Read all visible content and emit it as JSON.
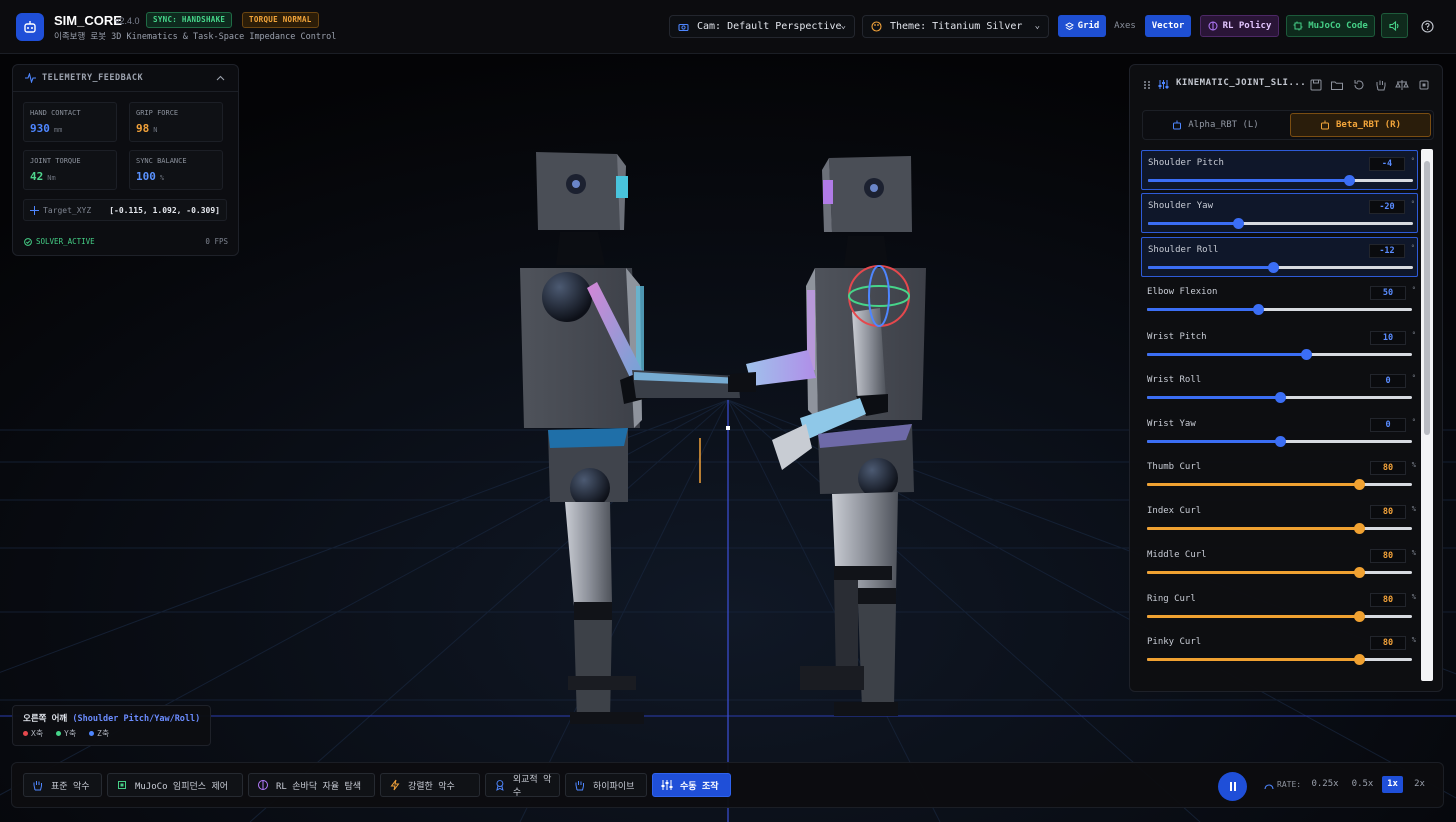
{
  "header": {
    "app_title": "SIM_CORE",
    "version": "v2.4.0",
    "subtitle": "이족보행 로봇 3D Kinematics & Task-Space Impedance Control",
    "badges": {
      "sync": "SYNC: HANDSHAKE",
      "torque": "TORQUE NORMAL"
    },
    "camera_select": "Cam: Default Perspective",
    "theme_select": "Theme: Titanium Silver",
    "toggles": {
      "grid": "Grid",
      "axes": "Axes",
      "vector": "Vector"
    },
    "rl_policy": "RL Policy",
    "mujoco_code": "MuJoCo Code"
  },
  "telemetry": {
    "title": "TELEMETRY_FEEDBACK",
    "hand_contact": {
      "label": "HAND CONTACT",
      "value": "930",
      "unit": "mm"
    },
    "grip_force": {
      "label": "GRIP FORCE",
      "value": "98",
      "unit": "N"
    },
    "joint_torque": {
      "label": "JOINT TORQUE",
      "value": "42",
      "unit": "Nm"
    },
    "sync_balance": {
      "label": "SYNC BALANCE",
      "value": "100",
      "unit": "%"
    },
    "target_label": "Target_XYZ",
    "target_value": "[-0.115, 1.092, -0.309]",
    "solver": "SOLVER_ACTIVE",
    "fps": "0 FPS"
  },
  "joint_panel": {
    "title": "KINEMATIC_JOINT_SLI...",
    "tabs": {
      "alpha": "Alpha_RBT (L)",
      "beta": "Beta_RBT (R)"
    },
    "joints": [
      {
        "name": "Shoulder Pitch",
        "value": "-4",
        "unit": "°",
        "level": 0.76,
        "color": "blue",
        "active": true
      },
      {
        "name": "Shoulder Yaw",
        "value": "-20",
        "unit": "°",
        "level": 0.34,
        "color": "blue",
        "active": true
      },
      {
        "name": "Shoulder Roll",
        "value": "-12",
        "unit": "°",
        "level": 0.47,
        "color": "blue",
        "active": true
      },
      {
        "name": "Elbow Flexion",
        "value": "50",
        "unit": "°",
        "level": 0.42,
        "color": "blue",
        "active": false
      },
      {
        "name": "Wrist Pitch",
        "value": "10",
        "unit": "°",
        "level": 0.6,
        "color": "blue",
        "active": false
      },
      {
        "name": "Wrist Roll",
        "value": "0",
        "unit": "°",
        "level": 0.5,
        "color": "blue",
        "active": false
      },
      {
        "name": "Wrist Yaw",
        "value": "0",
        "unit": "°",
        "level": 0.5,
        "color": "blue",
        "active": false
      },
      {
        "name": "Thumb Curl",
        "value": "80",
        "unit": "%",
        "level": 0.8,
        "color": "orange",
        "active": false
      },
      {
        "name": "Index Curl",
        "value": "80",
        "unit": "%",
        "level": 0.8,
        "color": "orange",
        "active": false
      },
      {
        "name": "Middle Curl",
        "value": "80",
        "unit": "%",
        "level": 0.8,
        "color": "orange",
        "active": false
      },
      {
        "name": "Ring Curl",
        "value": "80",
        "unit": "%",
        "level": 0.8,
        "color": "orange",
        "active": false
      },
      {
        "name": "Pinky Curl",
        "value": "80",
        "unit": "%",
        "level": 0.8,
        "color": "orange",
        "active": false
      }
    ]
  },
  "shoulder_legend": {
    "title": "오른쪽 어깨",
    "title_detail": "(Shoulder Pitch/Yaw/Roll)",
    "x_axis": "X축",
    "y_axis": "Y축",
    "z_axis": "Z축"
  },
  "modes": [
    {
      "label": "표준 악수",
      "icon": "hand-icon",
      "active": false
    },
    {
      "label": "MuJoCo 임피던스 제어",
      "icon": "chip-icon",
      "active": false
    },
    {
      "label": "RL 손바닥 자율 탐색",
      "icon": "brain-icon",
      "active": false
    },
    {
      "label": "강렬한 악수",
      "icon": "bolt-icon",
      "active": false
    },
    {
      "label": "외교적 악수",
      "icon": "award-icon",
      "active": false
    },
    {
      "label": "하이파이브",
      "icon": "hand-icon",
      "active": false
    },
    {
      "label": "수동 조작",
      "icon": "sliders-icon",
      "active": true
    }
  ],
  "playback": {
    "rate_label": "RATE:",
    "rates": [
      "0.25x",
      "0.5x",
      "1x",
      "2x"
    ],
    "active_rate": "1x"
  },
  "colors": {
    "accent": "#1f4fd8",
    "green": "#45cf86",
    "orange": "#f2a23a",
    "purple": "#b57bff"
  }
}
